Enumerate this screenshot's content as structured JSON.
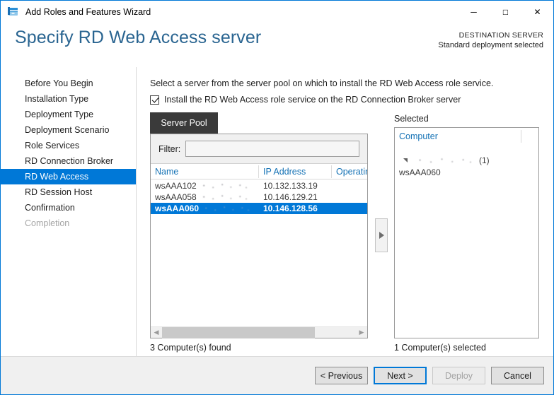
{
  "window": {
    "title": "Add Roles and Features Wizard",
    "icon": "wizard-server-icon",
    "minimize": "─",
    "maximize": "□",
    "close": "✕",
    "accent_color": "#0078d7"
  },
  "header": {
    "page_title": "Specify RD Web Access server",
    "destination_label": "DESTINATION SERVER",
    "destination_value": "Standard deployment selected"
  },
  "sidebar": {
    "items": [
      {
        "label": "Before You Begin",
        "state": "normal"
      },
      {
        "label": "Installation Type",
        "state": "normal"
      },
      {
        "label": "Deployment Type",
        "state": "normal"
      },
      {
        "label": "Deployment Scenario",
        "state": "normal"
      },
      {
        "label": "Role Services",
        "state": "normal"
      },
      {
        "label": "RD Connection Broker",
        "state": "normal"
      },
      {
        "label": "RD Web Access",
        "state": "selected"
      },
      {
        "label": "RD Session Host",
        "state": "normal"
      },
      {
        "label": "Confirmation",
        "state": "normal"
      },
      {
        "label": "Completion",
        "state": "disabled"
      }
    ]
  },
  "main": {
    "intro_text": "Select a server from the server pool on which to install the RD Web Access role service.",
    "checkbox": {
      "label": "Install the RD Web Access role service on the RD Connection Broker server",
      "checked": true
    },
    "tab_label": "Server Pool",
    "filter": {
      "label": "Filter:",
      "value": "",
      "placeholder": ""
    },
    "columns": [
      {
        "label": "Name"
      },
      {
        "label": "IP Address"
      },
      {
        "label": "Operating"
      }
    ],
    "rows": [
      {
        "name": "wsAAA102",
        "name_redacted": true,
        "ip": "10.132.133.19",
        "os": "",
        "selected": false
      },
      {
        "name": "wsAAA058",
        "name_redacted": true,
        "ip": "10.146.129.21",
        "os": "",
        "selected": false
      },
      {
        "name": "wsAAA060",
        "name_redacted": true,
        "ip": "10.146.128.56",
        "os": "",
        "selected": true
      }
    ],
    "pool_status": "3 Computer(s) found",
    "move_button_icon": "triangle-right-icon",
    "selected_panel": {
      "label": "Selected",
      "column": "Computer",
      "group_name_redacted": true,
      "group_count": "(1)",
      "child": "wsAAA060",
      "status": "1 Computer(s) selected"
    }
  },
  "footer": {
    "buttons": [
      {
        "label": "< Previous",
        "state": "normal"
      },
      {
        "label": "Next >",
        "state": "default"
      },
      {
        "label": "Deploy",
        "state": "disabled"
      },
      {
        "label": "Cancel",
        "state": "normal"
      }
    ]
  }
}
